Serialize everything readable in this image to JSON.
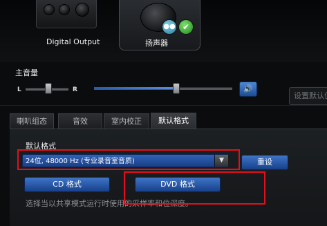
{
  "devices": [
    {
      "label": "Digital Output",
      "selected": false
    },
    {
      "label": "扬声器",
      "selected": true
    }
  ],
  "badges": {
    "chat": "chat-icon",
    "check": "✔"
  },
  "master_volume": {
    "label": "主音量",
    "balance_left": "L",
    "balance_right": "R",
    "balance_value": 0.5,
    "volume_value": 0.6,
    "mute_icon": "🔊"
  },
  "set_default_label": "设置默认值",
  "tabs": [
    {
      "label": "喇叭组态"
    },
    {
      "label": "音效"
    },
    {
      "label": "室内校正"
    },
    {
      "label": "默认格式",
      "active": true
    }
  ],
  "default_format": {
    "label": "默认格式",
    "selected_value": "24位, 48000 Hz (专业录音室音质)",
    "reset_label": "重设",
    "cd_label": "CD 格式",
    "dvd_label": "DVD 格式",
    "hint": "选择当以共享模式运行时使用的采样率和位深度。"
  },
  "colors": {
    "accent": "#2f62b6",
    "highlight": "#e2101b"
  }
}
